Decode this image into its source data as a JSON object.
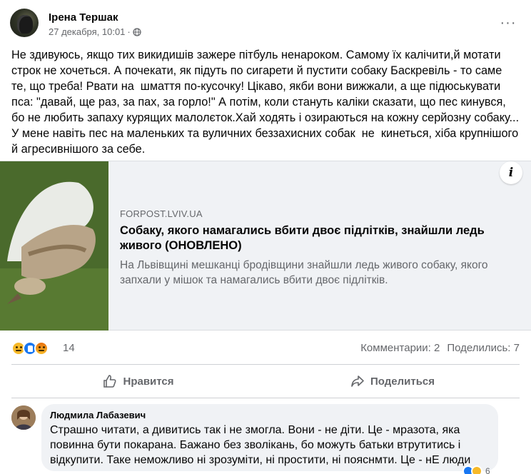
{
  "post": {
    "author": "Ірена Тершак",
    "timestamp": "27 декабря, 10:01",
    "separator": "·",
    "more_label": "···",
    "text": "Не здивуюсь, якщо тих викидишів зажере пітбуль ненароком. Самому їх калічити,й мотати строк не хочеться. А почекати, як підуть по сигарети й пустити собаку Баскревіль - то саме те, що треба! Рвати на  шмаття по-кусочку! Цікаво, якби вони вижжали, а ще підюськувати пса: \"давай, ще раз, за пах, за горло!\" А потім, коли стануть каліки сказати, що пес кинувся, бо не любить запаху курящих малолєток.Хай ходять і озираються на кожну серйозну собаку... У мене навіть пес на маленьких та вуличних беззахисних собак  не  кинеться, хіба крупнішого й агресивнішого за себе."
  },
  "link_preview": {
    "domain": "FORPOST.LVIV.UA",
    "title": "Собаку, якого намагались вбити двоє підлітків, знайшли ледь живого (ОНОВЛЕНО)",
    "description": "На Львівщині мешканці бродівщини знайшли ледь живого собаку, якого запхали у мішок та намагались вбити двоє підлітків.",
    "info_label": "i"
  },
  "reactions": {
    "icons": [
      "sad-icon",
      "like-icon",
      "angry-icon"
    ],
    "count": "14",
    "comments": "Комментарии: 2",
    "shares": "Поделились: 7"
  },
  "actions": {
    "like_label": "Нравится",
    "share_label": "Поделиться"
  },
  "comment": {
    "author": "Людмила Лабазевич",
    "text": "Страшно читати, а дивитись так і не змогла. Вони - не діти. Це - мразота, яка повинна бути покарана. Бажано без зволікань, бо можуть батьки втрутитись і відкупити. Таке неможливо ні зрозуміти, ні простити, ні пояснмти. Це - нЕ люди",
    "reaction_count": "6"
  },
  "colors": {
    "secondary_text": "#65676b",
    "card_bg": "#f0f2f5",
    "like_blue": "#1877f2"
  }
}
